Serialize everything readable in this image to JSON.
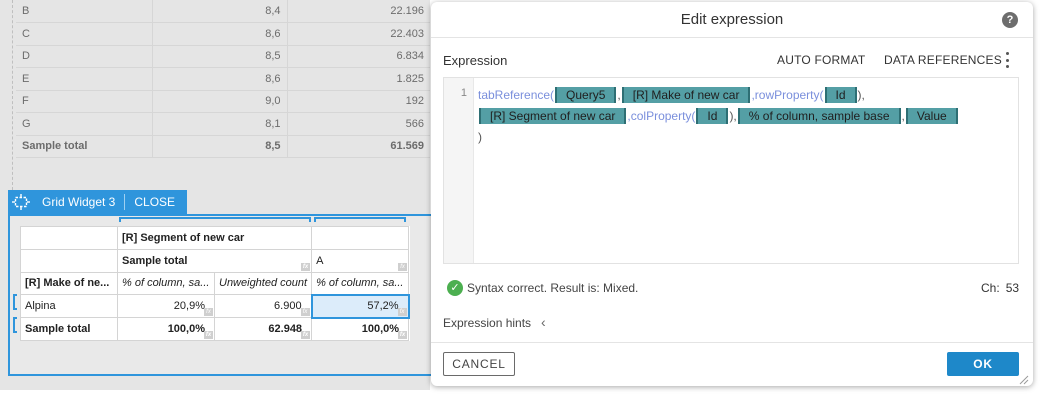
{
  "background_table": {
    "rows": [
      {
        "label": "B",
        "mean": "8,4",
        "count": "22.196"
      },
      {
        "label": "C",
        "mean": "8,6",
        "count": "22.403"
      },
      {
        "label": "D",
        "mean": "8,5",
        "count": "6.834"
      },
      {
        "label": "E",
        "mean": "8,6",
        "count": "1.825"
      },
      {
        "label": "F",
        "mean": "9,0",
        "count": "192"
      },
      {
        "label": "G",
        "mean": "8,1",
        "count": "566"
      },
      {
        "label": "Sample total",
        "mean": "8,5",
        "count": "61.569"
      }
    ]
  },
  "widget": {
    "title": "Grid Widget 3",
    "close_label": "CLOSE",
    "icon": "widget-select-icon",
    "accent_color": "#2f95dc",
    "header1": [
      "",
      "[R] Segment of new car",
      "",
      ""
    ],
    "header2": [
      "",
      "Sample total",
      "",
      "A"
    ],
    "header3": [
      "[R] Make of ne...",
      "% of column, sa...",
      "Unweighted count",
      "% of column, sa..."
    ],
    "rows": [
      [
        "Alpina",
        "20,9%",
        "6.900",
        "57,2%"
      ],
      [
        "Sample total",
        "100,0%",
        "62.948",
        "100,0%"
      ]
    ],
    "fx_glyph": "fx"
  },
  "dialog": {
    "title": "Edit expression",
    "help_glyph": "?",
    "expression_label": "Expression",
    "auto_format_label": "AUTO FORMAT",
    "data_references_label": "DATA REFERENCES",
    "line_number": "1",
    "code": {
      "fn_tab": "tabReference(",
      "tok_query": "Query5",
      "tok_make": "[R] Make of new car",
      "fn_row": ",rowProperty(",
      "tok_id1": "Id",
      "close_paren1": "),",
      "tok_segment": "[R] Segment of new car",
      "fn_col": ",colProperty(",
      "tok_id2": "Id",
      "close_paren2": "),",
      "tok_pct": "% of column, sample base",
      "tok_value": "Value",
      "final_paren": ")"
    },
    "status_text": "Syntax correct. Result is: Mixed.",
    "chars_label": "Ch:",
    "chars_value": "53",
    "hints_label": "Expression hints",
    "cancel_label": "CANCEL",
    "ok_label": "OK",
    "ok_color": "#1e88c9",
    "token_color": "#549fa5",
    "function_color": "#7a8fdc",
    "success_color": "#4caf50"
  }
}
